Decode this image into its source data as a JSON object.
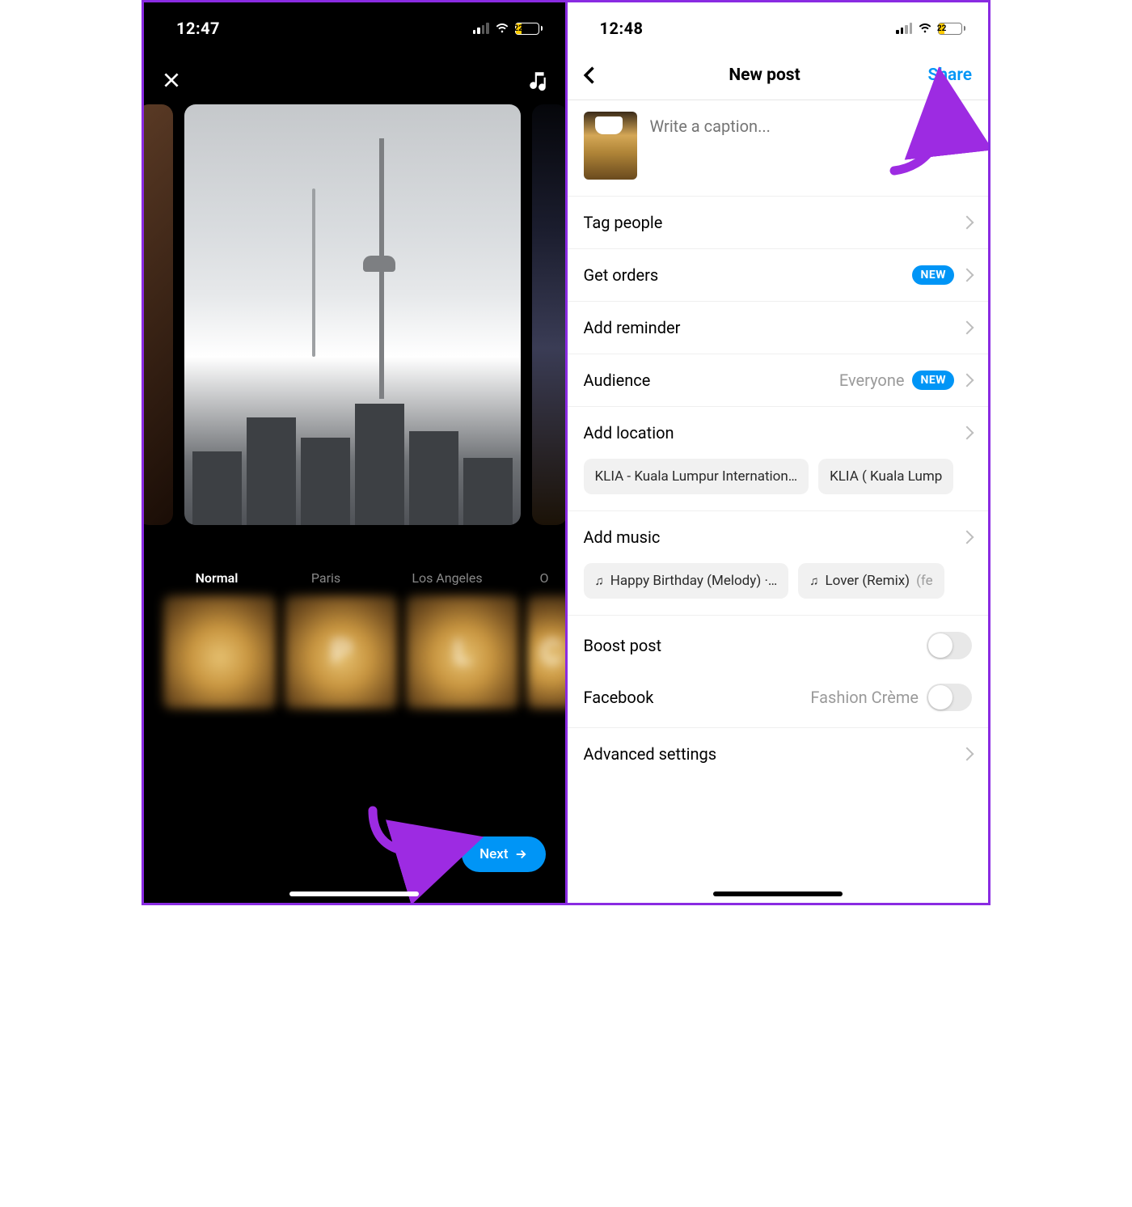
{
  "left": {
    "status": {
      "time": "12:47",
      "battery_pct": "22"
    },
    "filters": [
      "Normal",
      "Paris",
      "Los Angeles",
      "O"
    ],
    "filter_thumb_letters": [
      "",
      "P",
      "L",
      "C"
    ],
    "next_label": "Next"
  },
  "right": {
    "status": {
      "time": "12:48",
      "battery_pct": "22"
    },
    "header": {
      "title": "New post",
      "share": "Share"
    },
    "caption_placeholder": "Write a caption...",
    "rows": {
      "tag_people": "Tag people",
      "get_orders": "Get orders",
      "add_reminder": "Add reminder",
      "audience": "Audience",
      "audience_value": "Everyone",
      "add_location": "Add location",
      "add_music": "Add music",
      "boost_post": "Boost post",
      "facebook": "Facebook",
      "facebook_value": "Fashion Crème",
      "advanced": "Advanced settings"
    },
    "badge_new": "NEW",
    "location_chips": [
      "KLIA - Kuala Lumpur Internation…",
      "KLIA ( Kuala Lump"
    ],
    "music_chips": [
      {
        "text": "Happy Birthday (Melody) ·…",
        "faded": ""
      },
      {
        "text": "Lover (Remix)",
        "faded": " (fe"
      }
    ]
  }
}
